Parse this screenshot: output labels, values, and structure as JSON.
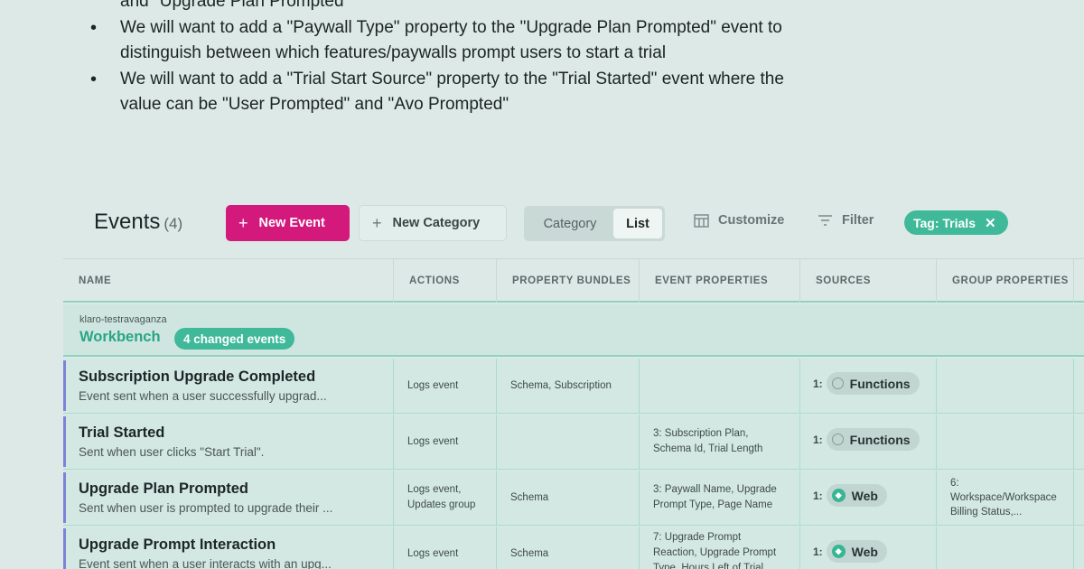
{
  "doc": {
    "lines": [
      {
        "bullet": "",
        "text": "and \"Upgrade Plan Prompted\""
      },
      {
        "bullet": "•",
        "text": "We will want to add a \"Paywall Type\" property to the \"Upgrade Plan Prompted\" event to"
      },
      {
        "bullet": "",
        "text": "distinguish between which features/paywalls prompt users to start a trial"
      },
      {
        "bullet": "•",
        "text": "We will want to add a \"Trial Start Source\" property to the \"Trial Started\" event where the"
      },
      {
        "bullet": "",
        "text": "value can be \"User Prompted\" and \"Avo Prompted\""
      }
    ]
  },
  "events_header": {
    "title": "Events",
    "count": "(4)",
    "new_event_label": "New Event",
    "new_category_label": "New Category",
    "view_toggle": {
      "category": "Category",
      "list": "List",
      "selected": "List"
    },
    "customize_label": "Customize",
    "filter_label": "Filter",
    "tag_filter": "Tag: Trials"
  },
  "table": {
    "columns": [
      "NAME",
      "ACTIONS",
      "PROPERTY BUNDLES",
      "EVENT PROPERTIES",
      "SOURCES",
      "GROUP PROPERTIES"
    ],
    "group": {
      "branch": "klaro-testravaganza",
      "name": "Workbench",
      "badge": "4 changed events"
    },
    "rows": [
      {
        "name": "Subscription Upgrade Completed",
        "description": "Event sent when a user successfully upgrad...",
        "actions": [
          "Logs event"
        ],
        "bundles": "Schema, Subscription",
        "event_properties": [],
        "source_count": "1:",
        "source": "Functions",
        "source_icon": "empty-circle-icon",
        "group_properties": []
      },
      {
        "name": "Trial Started",
        "description": "Sent when user clicks \"Start Trial\".",
        "actions": [
          "Logs event"
        ],
        "bundles": "",
        "event_properties": [
          "3: Subscription Plan,",
          "Schema Id, Trial Length"
        ],
        "source_count": "1:",
        "source": "Functions",
        "source_icon": "empty-circle-icon",
        "group_properties": []
      },
      {
        "name": "Upgrade Plan Prompted",
        "description": "Sent when user is prompted to upgrade their ...",
        "actions": [
          "Logs event,",
          "Updates group"
        ],
        "bundles": "Schema",
        "event_properties": [
          "3: Paywall Name, Upgrade",
          "Prompt Type, Page Name"
        ],
        "source_count": "1:",
        "source": "Web",
        "source_icon": "web-icon",
        "group_properties": [
          "6:",
          "Workspace/Workspace",
          "Billing Status,..."
        ]
      },
      {
        "name": "Upgrade Prompt Interaction",
        "description": "Event sent when a user interacts with an upg...",
        "actions": [
          "Logs event"
        ],
        "bundles": "Schema",
        "event_properties": [
          "7: Upgrade Prompt",
          "Reaction, Upgrade Prompt",
          "Type, Hours Left of Trial..."
        ],
        "source_count": "1:",
        "source": "Web",
        "source_icon": "web-icon",
        "group_properties": []
      }
    ]
  },
  "colors": {
    "background": "#dce9e6",
    "primary_button": "#d4197c",
    "accent_green": "#3fb99a",
    "row_accent": "#7b85d8"
  }
}
